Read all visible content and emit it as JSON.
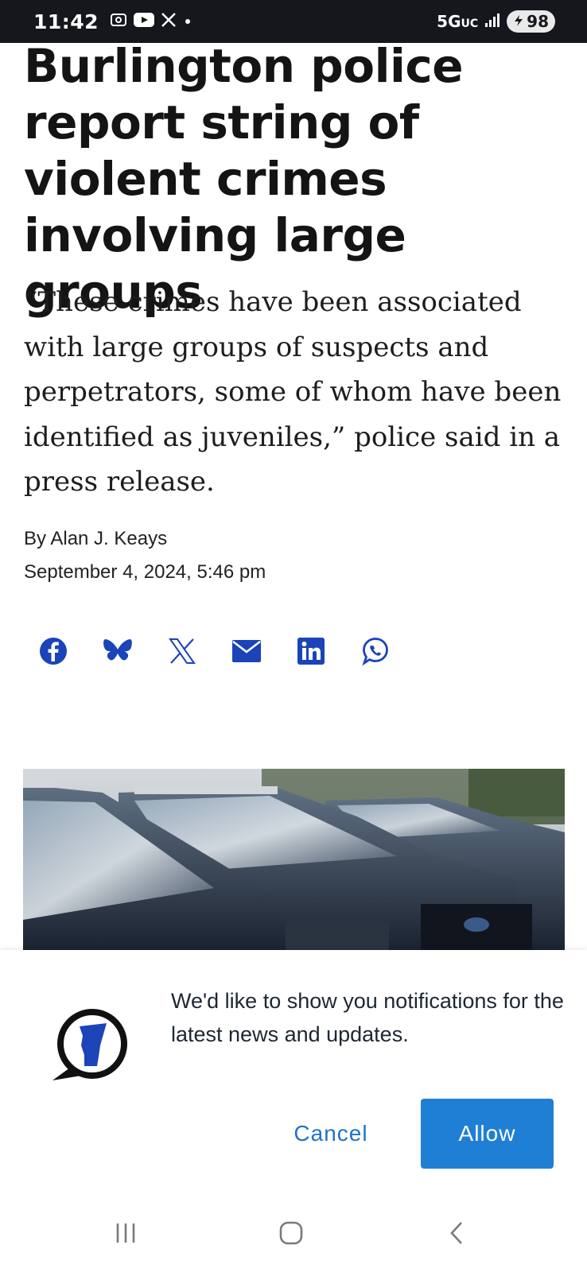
{
  "status_bar": {
    "time": "11:42",
    "network": "5G",
    "network_suffix": "UC",
    "battery": "98",
    "icons": [
      "screenshot-icon",
      "youtube-icon",
      "x-icon",
      "dot-icon",
      "signal-icon",
      "battery-icon"
    ]
  },
  "article": {
    "headline": "Burlington police report string of violent crimes involving large groups",
    "dek": "“These crimes have been associated with large groups of suspects and perpetrators, some of whom have been identified as juveniles,” police said in a press release.",
    "byline": "By Alan J. Keays",
    "date": "September 4, 2024, 5:46 pm",
    "share_icons": [
      "facebook-icon",
      "bluesky-icon",
      "x-icon",
      "email-icon",
      "linkedin-icon",
      "whatsapp-icon"
    ],
    "accent_color": "#1a44b8"
  },
  "notification_prompt": {
    "message": "We'd like to show you notifications for the latest news and updates.",
    "cancel_label": "Cancel",
    "allow_label": "Allow",
    "allow_color": "#1f7fd4"
  },
  "nav_bar": {
    "icons": [
      "recents-icon",
      "home-icon",
      "back-icon"
    ]
  }
}
